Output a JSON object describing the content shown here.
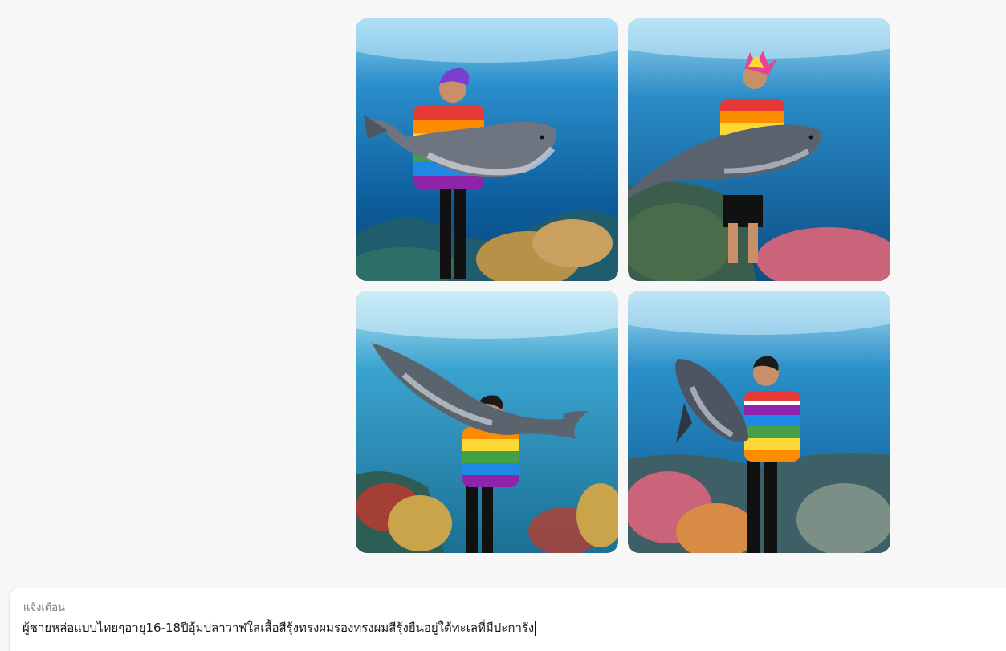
{
  "images": [
    {
      "name": "generated-image-1",
      "shirt": "rainbow-long-sleeve",
      "hair": "purple"
    },
    {
      "name": "generated-image-2",
      "shirt": "rainbow-tshirt",
      "hair": "rainbow-mohawk"
    },
    {
      "name": "generated-image-3",
      "shirt": "rainbow-tshirt",
      "hair": "black"
    },
    {
      "name": "generated-image-4",
      "shirt": "rainbow-striped-tshirt",
      "hair": "black"
    }
  ],
  "prompt": {
    "label": "แจ้งเตือน",
    "value": "ผู้ชายหล่อแบบไทยๆอายุ16-18ปีอุ้มปลาวาฬใส่เสื้อสีรุ้งทรงผมรองทรงผมสีรุ้งยืนอยู่ใต้ทะเลที่มีปะการัง"
  },
  "colors": {
    "background": "#f7f7f7",
    "ocean_light": "#5fb7e0",
    "ocean_deep": "#0b4f8a",
    "coral_pink": "#c9647a",
    "coral_yellow": "#b89148"
  }
}
